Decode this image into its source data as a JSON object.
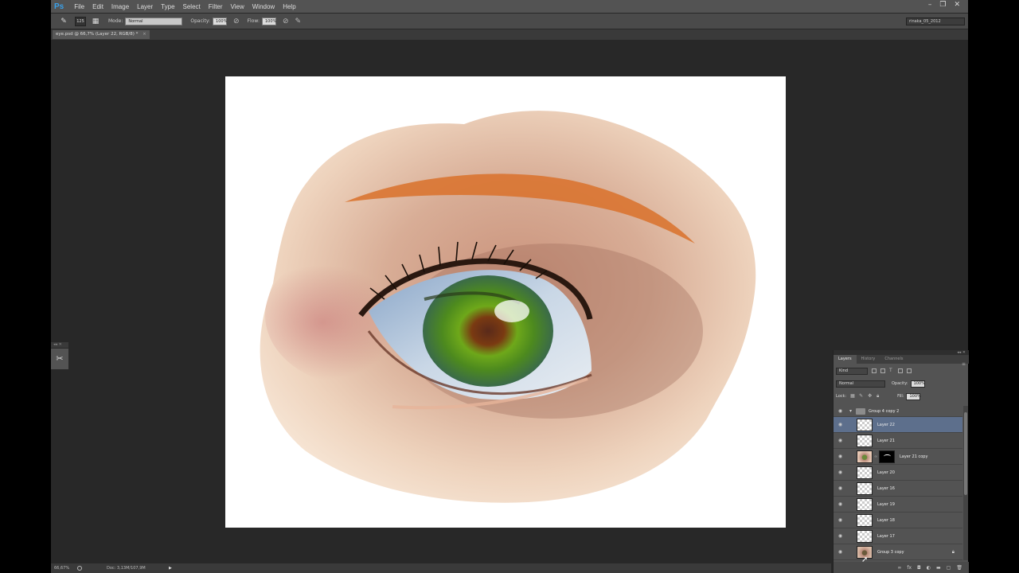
{
  "app": {
    "logo": "Ps"
  },
  "menu": [
    "File",
    "Edit",
    "Image",
    "Layer",
    "Type",
    "Select",
    "Filter",
    "View",
    "Window",
    "Help"
  ],
  "window_controls": [
    "–",
    "❐",
    "✕"
  ],
  "options": {
    "brush_size": "125",
    "mode_label": "Mode:",
    "mode_value": "Normal",
    "opacity_label": "Opacity:",
    "opacity_value": "100%",
    "flow_label": "Flow:",
    "flow_value": "100%",
    "workspace": "rinaka_05_2012"
  },
  "document": {
    "tab_label": "eye.psd @ 66,7% (Layer 22, RGB/8) *",
    "close": "×"
  },
  "status": {
    "zoom": "66,67%",
    "doc": "Doc: 3,13M/107,9M",
    "arrow": "▶"
  },
  "layers_panel": {
    "tabs": [
      "Layers",
      "History",
      "Channels"
    ],
    "kind_label": "Kind",
    "blend_mode": "Normal",
    "opacity_label": "Opacity:",
    "opacity_value": "100%",
    "lock_label": "Lock:",
    "fill_label": "Fill:",
    "fill_value": "100%",
    "layers": [
      {
        "name": "Group 4 copy 2",
        "type": "group"
      },
      {
        "name": "Layer 22",
        "type": "layer",
        "selected": true
      },
      {
        "name": "Layer 21",
        "type": "layer"
      },
      {
        "name": "Layer 21 copy",
        "type": "masked"
      },
      {
        "name": "Layer 20",
        "type": "layer"
      },
      {
        "name": "Layer 16",
        "type": "layer"
      },
      {
        "name": "Layer 19",
        "type": "layer"
      },
      {
        "name": "Layer 18",
        "type": "layer"
      },
      {
        "name": "Layer 17",
        "type": "layer"
      },
      {
        "name": "Group 3 copy",
        "type": "group-thumb"
      }
    ]
  }
}
